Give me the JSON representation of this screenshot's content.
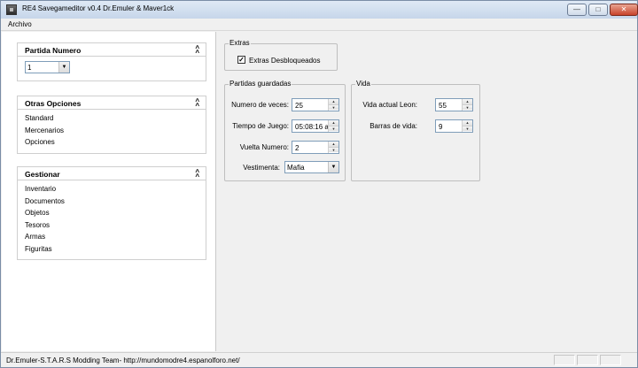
{
  "window": {
    "title": "RE4 Savegameditor v0.4 Dr.Emuler & Maver1ck"
  },
  "menu": {
    "file": "Archivo"
  },
  "sidebar": {
    "partida": {
      "title": "Partida Numero",
      "selected": "1"
    },
    "otras": {
      "title": "Otras Opciones",
      "items": [
        "Standard",
        "Mercenarios",
        "Opciones"
      ]
    },
    "gestionar": {
      "title": "Gestionar",
      "items": [
        "Inventario",
        "Documentos",
        "Objetos",
        "Tesoros",
        "Armas",
        "Figuritas"
      ]
    }
  },
  "extras": {
    "title": "Extras",
    "checkbox_label": "Extras Desbloqueados",
    "checked": true
  },
  "partidas": {
    "title": "Partidas guardadas",
    "numero_veces": {
      "label": "Numero de veces:",
      "value": "25"
    },
    "tiempo": {
      "label": "Tiempo de Juego:",
      "value": "05:08:16 a"
    },
    "vuelta": {
      "label": "Vuelta Numero:",
      "value": "2"
    },
    "vestimenta": {
      "label": "Vestimenta:",
      "value": "Mafia"
    }
  },
  "vida": {
    "title": "Vida",
    "actual": {
      "label": "Vida actual Leon:",
      "value": "55"
    },
    "barras": {
      "label": "Barras de vida:",
      "value": "9"
    }
  },
  "status": {
    "text": "Dr.Emuler-S.T.A.R.S Modding Team- http://mundomodre4.espanolforo.net/"
  }
}
